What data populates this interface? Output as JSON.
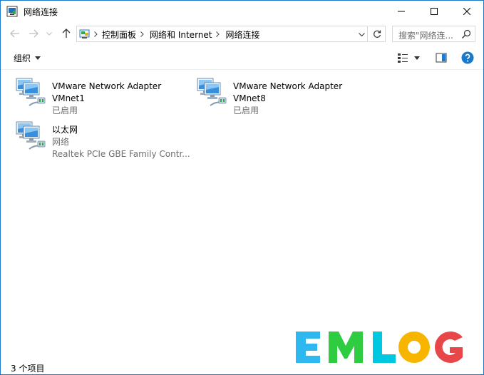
{
  "window": {
    "title": "网络连接",
    "icon": "network-connections-icon"
  },
  "title_buttons": {
    "minimize": "minimize-icon",
    "maximize": "maximize-icon",
    "close": "close-icon"
  },
  "navigation": {
    "back": "arrow-left-icon",
    "forward": "arrow-right-icon",
    "recent": "chevron-down-icon",
    "up": "arrow-up-icon"
  },
  "address": {
    "breadcrumbs": [
      "控制面板",
      "网络和 Internet",
      "网络连接"
    ]
  },
  "search": {
    "placeholder": "搜索\"网络连..."
  },
  "toolbar": {
    "organize_label": "组织"
  },
  "items": [
    {
      "name": "VMware Network Adapter",
      "name2": "VMnet1",
      "status": "已启用"
    },
    {
      "name": "VMware Network Adapter",
      "name2": "VMnet8",
      "status": "已启用"
    },
    {
      "name": "以太网",
      "name2": "网络",
      "status": "Realtek PCIe GBE Family Contr..."
    }
  ],
  "statusbar": {
    "item_count": "3 个项目"
  },
  "watermark": {
    "text": "EMLOG",
    "colors": [
      "#2fb8f0",
      "#2ecc40",
      "#00c8e0",
      "#f7b500",
      "#e8474a"
    ]
  },
  "colors": {
    "window_border": "#1979ca",
    "help_blue": "#1979ca",
    "secondary_text": "#6d6d6d"
  }
}
